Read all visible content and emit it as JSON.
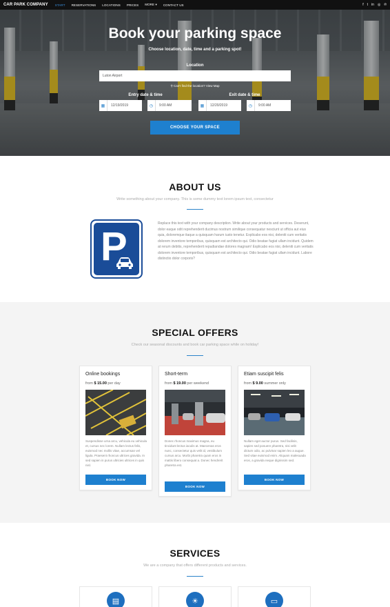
{
  "nav": {
    "brand": "CAR PARK COMPANY",
    "items": [
      {
        "label": "START",
        "active": true
      },
      {
        "label": "RESERVATIONS",
        "active": false
      },
      {
        "label": "LOCATIONS",
        "active": false
      },
      {
        "label": "PRICES",
        "active": false
      },
      {
        "label": "MORE ▾",
        "active": false
      },
      {
        "label": "CONTACT US",
        "active": false
      }
    ],
    "social": [
      "facebook-icon",
      "twitter-icon",
      "linkedin-icon",
      "instagram-icon",
      "pinterest-icon"
    ],
    "social_glyphs": [
      "f",
      "t",
      "in",
      "◎",
      "℗"
    ]
  },
  "hero": {
    "title": "Book your parking space",
    "subtitle": "Choose location, date, time and a parking spot!",
    "location_label": "Location",
    "location_value": "Luton Airport",
    "location_help": "Can't find the location? View Map",
    "entry_label": "Entry date & time",
    "exit_label": "Exit date & time",
    "entry_date": "12/19/2019",
    "entry_time": "9:00 AM",
    "exit_date": "12/20/2019",
    "exit_time": "9:00 AM",
    "cta": "CHOOSE YOUR SPACE"
  },
  "about": {
    "title": "ABOUT US",
    "subtitle": "Write something about your company. This is some dummy text lorem ipsum text, consectetur",
    "text": "Replace this text with your company description. Write about your products and services. Deserunt, dolor eaque odit reprehenderit ducimus nostrum similique consequatur nesciunt ut officia aut eius quia, doloremque itaque a quisquam harum iusto tenetur. Explicabo eos nisi, deleniti cum veritatis dolorem inventore temporibus, quisquam est architecto qui. Odio beatae fugiat ullam incidunt. Quidem at rerum debitis, reprehenderit repudiandae dolores magnam! Explicabo eos nisi, deleniti cum veritatis dolorem inventore temporibus, quisquam est architecto qui. Odio beatae fugiat ullam incidunt. Labore distinctio dolor corporis?"
  },
  "offers": {
    "title": "SPECIAL OFFERS",
    "subtitle": "Check our seasonal discounts and book car parking space while on holiday!",
    "cards": [
      {
        "title": "Online bookings",
        "from": "from",
        "price": "$ 15.00",
        "period": "per day",
        "text": "Suspendisse urna arcu, vehicula eu vehicula et, cursus nec lorem. Nullam lectus felis, euismod nec mollis vitae, accumsan vel ligula. Praesent rhoncus ultrices gravida. In sed sapien in purus ultricies ultrices in quis nisl.",
        "button": "BOOK NOW"
      },
      {
        "title": "Short-term",
        "from": "from",
        "price": "$ 19.00",
        "period": "per weekend",
        "text": "Donec rhoncus maximus magna, eu tincidunt lectus iaculis at. Maecenas eros nunc, consectetur quis velit id, vestibulum cursus arcu. Morbi pharetra quam eros in mattis libero consequat a. Donec hendrerit pharetra est.",
        "button": "BOOK NOW"
      },
      {
        "title": "Etiam suscipit felis",
        "from": "from",
        "price": "$ 9.00",
        "period": "summer only",
        "text": "Nullam eget auctor purus. Sed facilisis, sapien sed posuere pharetra, nisi velit dictum odio, ac pulvinar sapien leo a augue. Sed vitae euismod enim. Aliquam malesuada eros, a gravida neque dignissim sed.",
        "button": "BOOK NOW"
      }
    ]
  },
  "services": {
    "title": "SERVICES",
    "subtitle": "We are a company that offers different products and services.",
    "icons": [
      "id-card-icon",
      "lightbulb-icon",
      "credit-card-icon"
    ],
    "glyphs": [
      "▤",
      "☀",
      "▭"
    ]
  },
  "colors": {
    "accent": "#1e80cf",
    "sign_blue": "#1a4c98",
    "nav_bg": "#111111",
    "offers_bg": "#f4f4f4"
  }
}
